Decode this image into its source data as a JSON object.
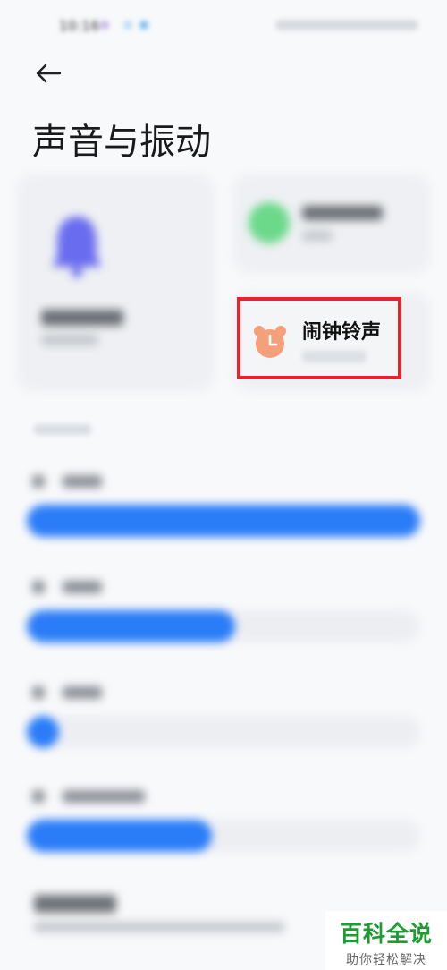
{
  "status_bar": {
    "time": "10:16"
  },
  "header": {
    "title": "声音与振动"
  },
  "cards": {
    "alarm_ringtone": {
      "label": "闹钟铃声",
      "icon": "alarm-clock-icon",
      "icon_color": "#f5a07a"
    },
    "incoming_call_ringtone": {
      "icon": "phone-icon",
      "icon_color": "#6cd98a"
    },
    "notification_sound": {
      "icon": "bell-icon",
      "icon_color": "#6a6cf0"
    }
  },
  "volume_sliders": [
    {
      "level": 1.0
    },
    {
      "level": 0.53
    },
    {
      "level": 0.04
    },
    {
      "level": 0.47
    }
  ],
  "colors": {
    "accent": "#2a7cf7",
    "highlight": "#e4262c",
    "watermark_green": "#1e9c33"
  },
  "watermark": {
    "title": "百科全说",
    "subtitle": "助你轻松解决"
  }
}
